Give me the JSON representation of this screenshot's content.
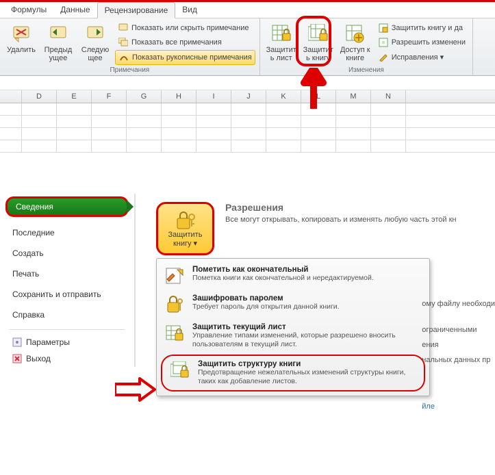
{
  "ribbon_tabs": {
    "formulas": "Формулы",
    "data": "Данные",
    "review": "Рецензирование",
    "view": "Вид"
  },
  "comments_group": {
    "delete": "Удалить",
    "previous": "Предыдущее",
    "next": "Следующее",
    "show_hide": "Показать или скрыть примечание",
    "show_all": "Показать все примечания",
    "show_ink": "Показать рукописные примечания",
    "label": "Примечания"
  },
  "changes_group": {
    "protect_sheet": "Защитить лист",
    "protect_workbook": "Защитить книгу",
    "share_workbook": "Доступ к книге",
    "protect_share": "Защитить книгу и да",
    "allow_ranges": "Разрешить изменени",
    "track_changes": "Исправления ▾",
    "label": "Изменения"
  },
  "columns": [
    "D",
    "E",
    "F",
    "G",
    "H",
    "I",
    "J",
    "K",
    "L",
    "M",
    "N"
  ],
  "backstage": {
    "info": "Сведения",
    "recent": "Последние",
    "new": "Создать",
    "print": "Печать",
    "save_send": "Сохранить и отправить",
    "help": "Справка",
    "options": "Параметры",
    "exit": "Выход"
  },
  "permissions": {
    "title": "Разрешения",
    "desc": "Все могут открывать, копировать и изменять любую часть этой кн",
    "button": "Защитить книгу ▾"
  },
  "menu": {
    "final_t": "Пометить как окончательный",
    "final_d": "Пометка книги как окончательной и нередактируемой.",
    "encrypt_t": "Зашифровать паролем",
    "encrypt_d": "Требует пароль для открытия данной книги.",
    "sheet_t": "Защитить текущий лист",
    "sheet_d": "Управление типами изменений, которые разрешено вносить пользователям в текущий лист.",
    "struct_t": "Защитить структуру книги",
    "struct_d": "Предотвращение нежелательных изменений структуры книги, таких как добавление листов."
  },
  "side_text": {
    "l1": "ому файлу необходи",
    "l2": "ограниченными",
    "l3": "ения",
    "l4": "нальных данных пр",
    "l5": "йле"
  }
}
